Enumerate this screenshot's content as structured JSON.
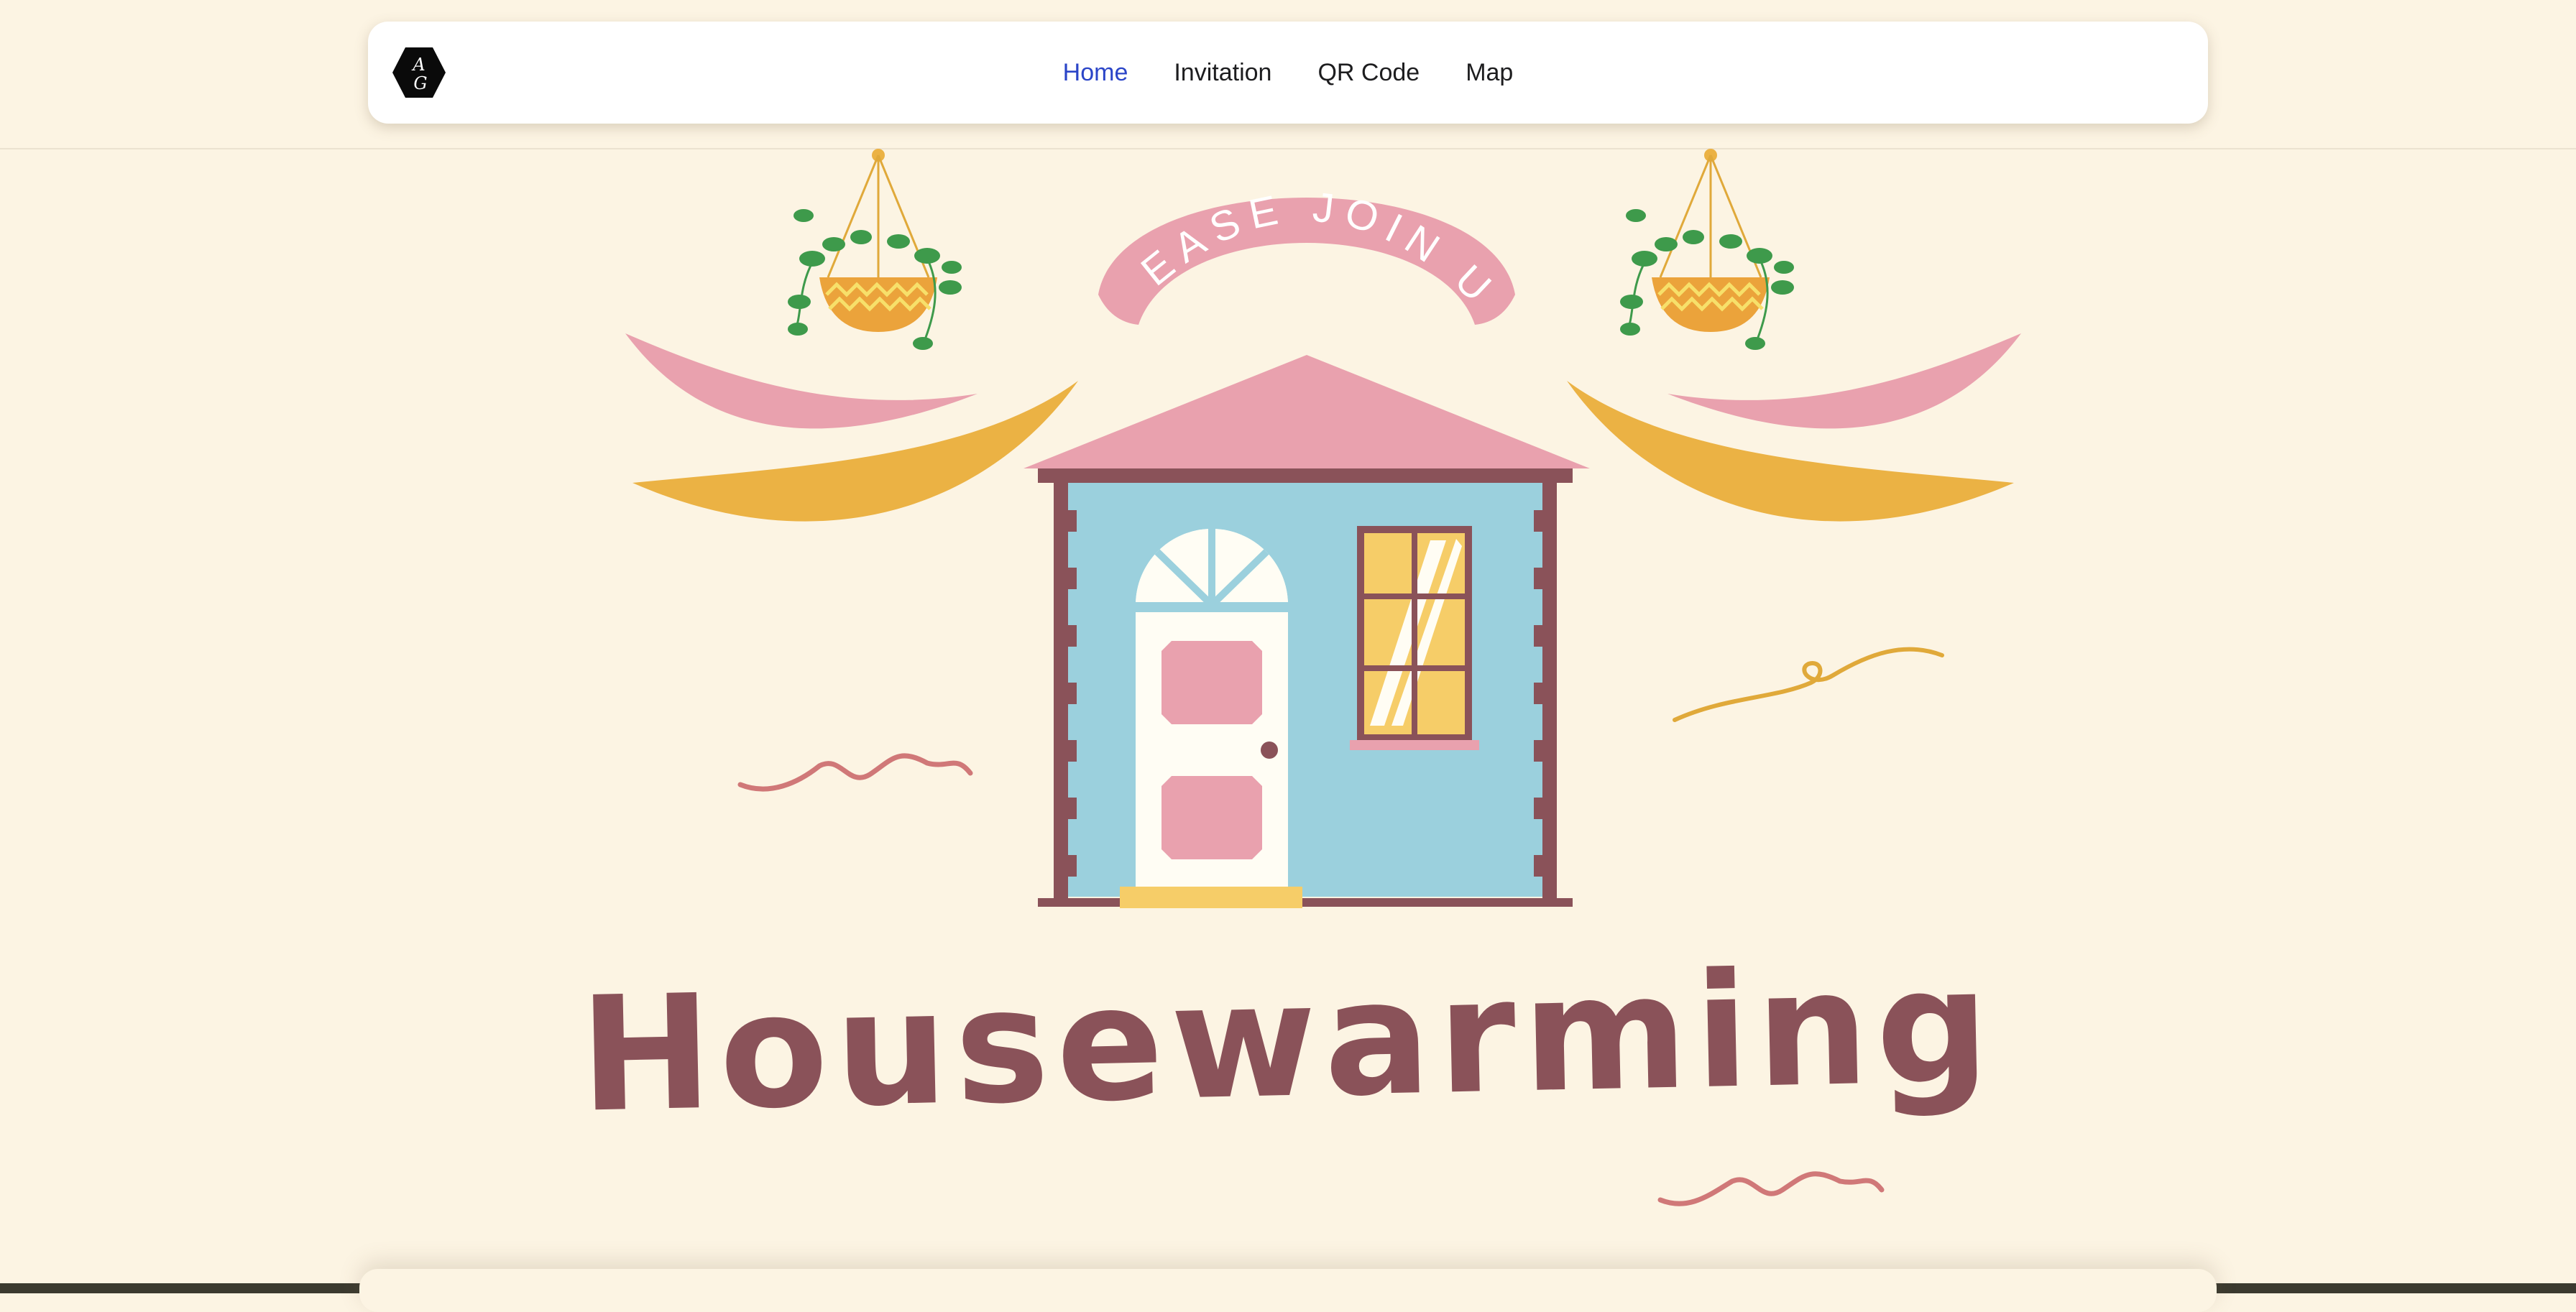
{
  "nav": {
    "items": [
      {
        "label": "Home",
        "active": true
      },
      {
        "label": "Invitation",
        "active": false
      },
      {
        "label": "QR Code",
        "active": false
      },
      {
        "label": "Map",
        "active": false
      }
    ],
    "active_color": "#2B45C8",
    "logo_initials": "AG"
  },
  "hero": {
    "banner": "PLEASE JOIN US",
    "title": "Housewarming"
  },
  "colors": {
    "background": "#FCF4E3",
    "pink": "#E9A1AE",
    "gold": "#EBB244",
    "blue": "#9BD0DD",
    "brown": "#8A5259"
  }
}
